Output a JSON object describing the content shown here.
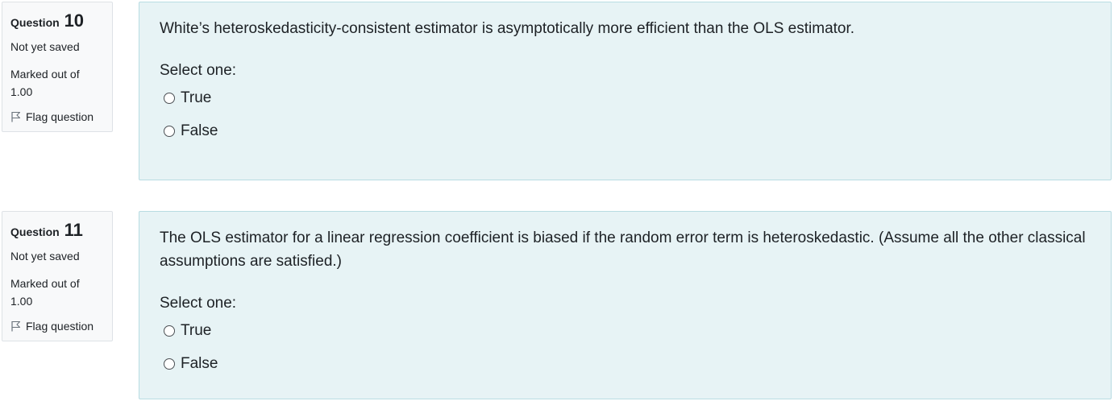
{
  "questions": [
    {
      "label": "Question",
      "number": "10",
      "state": "Not yet saved",
      "grade": "Marked out of 1.00",
      "flag_label": "Flag question",
      "text": "White’s heteroskedasticity-consistent estimator is asymptotically more efficient than the OLS estimator.",
      "prompt": "Select one:",
      "options": [
        "True",
        "False"
      ]
    },
    {
      "label": "Question",
      "number": "11",
      "state": "Not yet saved",
      "grade": "Marked out of 1.00",
      "flag_label": "Flag question",
      "text": "The OLS estimator for a linear regression coefficient is biased if the random error term is heteroskedastic. (Assume all the other classical assumptions are satisfied.)",
      "prompt": "Select one:",
      "options": [
        "True",
        "False"
      ]
    }
  ],
  "icons": {
    "flag": "flag-icon",
    "radio": "radio-unchecked-icon"
  },
  "colors": {
    "content_bg": "#e7f3f5",
    "content_border": "#b8dce2",
    "info_bg": "#f8f9fa",
    "info_border": "#dee2e6",
    "text": "#1d2125"
  }
}
